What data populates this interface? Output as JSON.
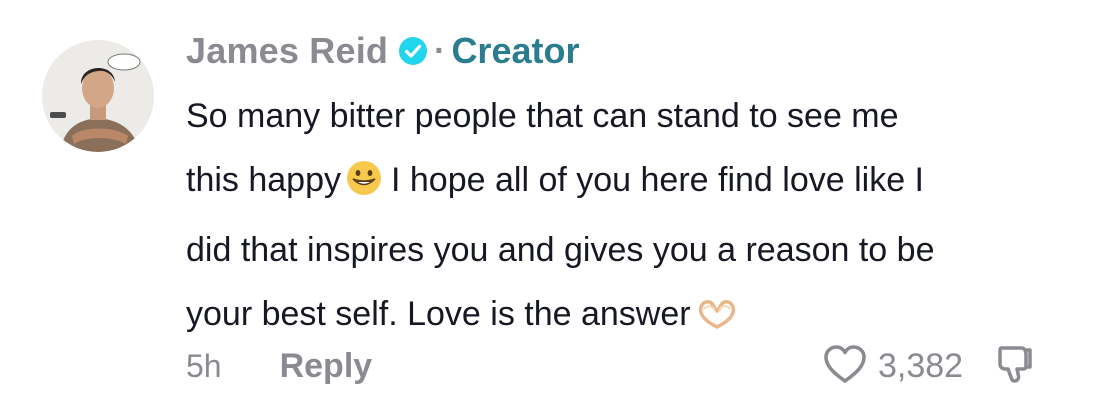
{
  "comment": {
    "username": "James Reid",
    "separator": "·",
    "badge_label": "Creator",
    "verified_icon": "verified-check-icon",
    "text_lines": [
      "So many bitter people that can stand to see me",
      "this happy",
      "I hope all of you here find love like I",
      "did that inspires you and gives you a reason to be",
      "your best self. Love is the answer"
    ],
    "emojis": [
      "grinning-face-icon",
      "heart-hands-icon"
    ],
    "timestamp": "5h",
    "reply_label": "Reply",
    "like_icon": "heart-outline-icon",
    "like_count": "3,382",
    "dislike_icon": "thumbs-down-icon",
    "colors": {
      "name": "#8a8b91",
      "creator": "#2a7c8f",
      "verified": "#20d5ec",
      "text": "#161823"
    }
  }
}
